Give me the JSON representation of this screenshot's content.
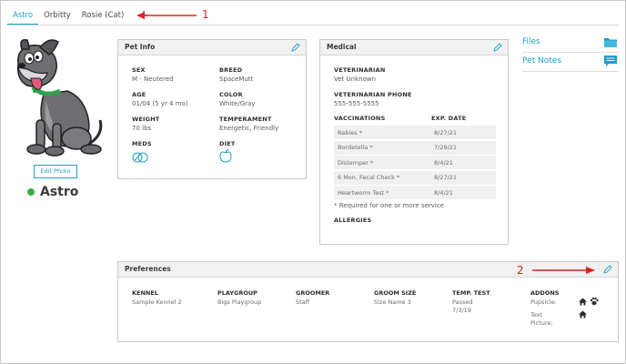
{
  "tabs": [
    {
      "label": "Astro",
      "active": true
    },
    {
      "label": "Orbitty",
      "active": false
    },
    {
      "label": "Rosie (Cat)",
      "active": false
    }
  ],
  "add_tab_label": "+",
  "annotations": {
    "one": "1",
    "two": "2",
    "color": "#e02020"
  },
  "profile": {
    "edit_photo_label": "Edit Photo",
    "pet_name": "Astro",
    "status_color": "#3aaa48"
  },
  "pet_info": {
    "title": "Pet Info",
    "sex_label": "SEX",
    "sex": "M - Neutered",
    "breed_label": "BREED",
    "breed": "SpaceMutt",
    "age_label": "AGE",
    "age": "01/04 (5 yr 4 mo)",
    "color_label": "COLOR",
    "color": "White/Gray",
    "weight_label": "WEIGHT",
    "weight": "70 lbs",
    "temperament_label": "TEMPERAMENT",
    "temperament": "Energetic, Friendly",
    "meds_label": "MEDS",
    "meds_icon": "pills-icon",
    "diet_label": "DIET",
    "diet_icon": "apple-icon"
  },
  "medical": {
    "title": "Medical",
    "vet_label": "VETERINARIAN",
    "vet": "Vet Unknown",
    "vet_phone_label": "VETERINARIAN PHONE",
    "vet_phone": "555-555-5555",
    "vacc_label": "VACCINATIONS",
    "exp_label": "EXP. DATE",
    "vaccinations": [
      {
        "name": "Rabies *",
        "date": "8/27/21"
      },
      {
        "name": "Bordetella *",
        "date": "7/29/21"
      },
      {
        "name": "Distemper *",
        "date": "8/4/21"
      },
      {
        "name": "6 Mon. Fecal Check *",
        "date": "8/27/21"
      },
      {
        "name": "Heartworm Test *",
        "date": "8/4/21"
      }
    ],
    "required_note": "* Required for one or more service",
    "allergies_label": "ALLERGIES"
  },
  "side": {
    "files_label": "Files",
    "notes_label": "Pet Notes",
    "files_icon": "folder-icon",
    "notes_icon": "notes-icon"
  },
  "preferences": {
    "title": "Preferences",
    "kennel_label": "KENNEL",
    "kennel": "Sample Kennel 2",
    "playgroup_label": "PLAYGROUP",
    "playgroup": "Bigs Playgroup",
    "groomer_label": "GROOMER",
    "groomer": "Staff",
    "groom_size_label": "GROOM SIZE",
    "groom_size": "Size Name 3",
    "temp_test_label": "TEMP. TEST",
    "temp_test_status": "Passed",
    "temp_test_date": "7/3/19",
    "addons_label": "ADDONS",
    "pupsicle": "Pupsicle:",
    "text_picture": "Text Picture:"
  },
  "colors": {
    "accent": "#1f9fc4",
    "header_bg": "#f1f1f1"
  }
}
